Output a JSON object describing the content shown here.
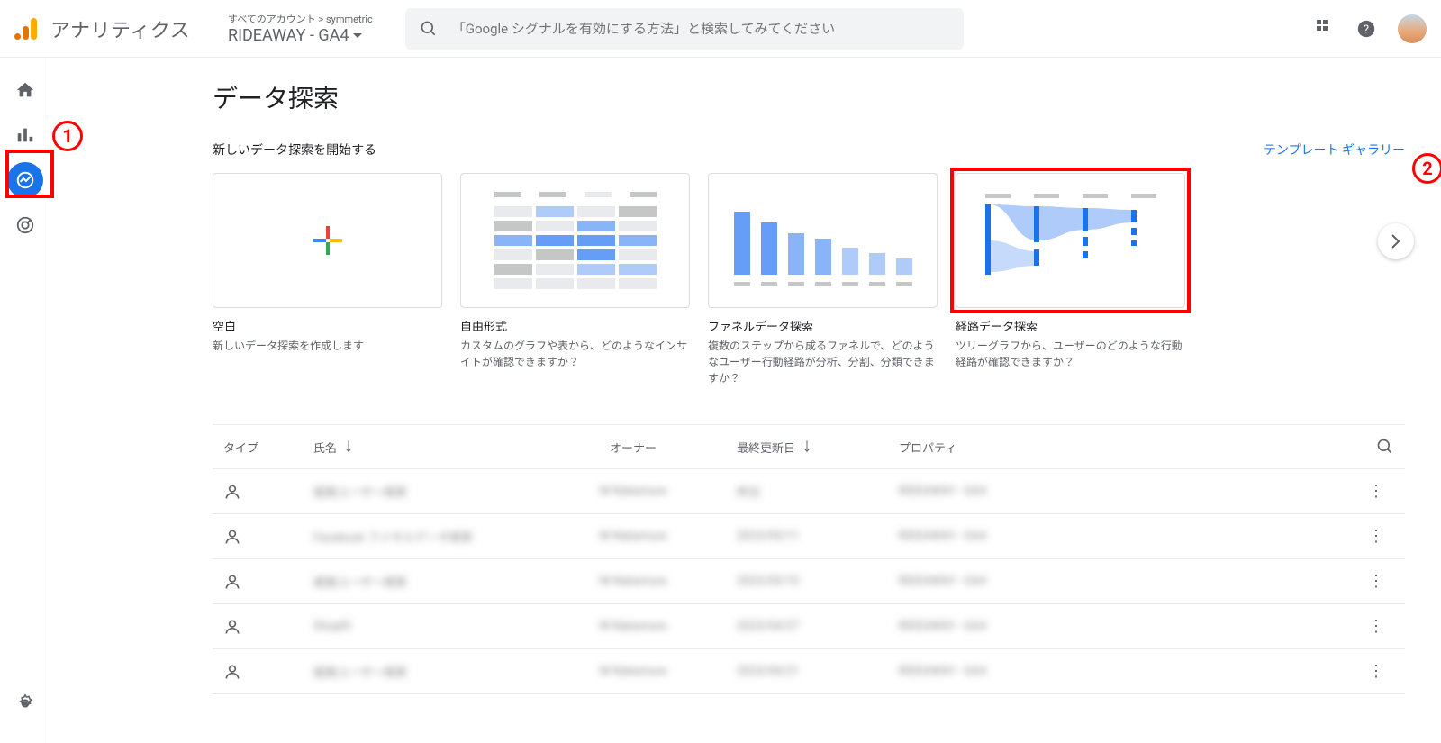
{
  "header": {
    "product_name": "アナリティクス",
    "account_path": "すべてのアカウント > symmetric",
    "property_name": "RIDEAWAY - GA4",
    "search_placeholder": "「Google シグナルを有効にする方法」と検索してみてください"
  },
  "annotations": {
    "one": "1",
    "two": "2"
  },
  "page": {
    "title": "データ探索",
    "start_new_label": "新しいデータ探索を開始する",
    "gallery_link": "テンプレート ギャラリー"
  },
  "templates": [
    {
      "title": "空白",
      "desc": "新しいデータ探索を作成します"
    },
    {
      "title": "自由形式",
      "desc": "カスタムのグラフや表から、どのようなインサイトが確認できますか？"
    },
    {
      "title": "ファネルデータ探索",
      "desc": "複数のステップから成るファネルで、どのようなユーザー行動経路が分析、分割、分類できますか？"
    },
    {
      "title": "経路データ探索",
      "desc": "ツリーグラフから、ユーザーのどのような行動経路が確認できますか？"
    }
  ],
  "table": {
    "headers": {
      "type": "タイプ",
      "name": "氏名",
      "owner": "オーナー",
      "last_modified": "最終更新日",
      "property": "プロパティ"
    },
    "rows": [
      {
        "name": "経路ユーザー探索",
        "owner": "M Nakamura",
        "date": "昨日",
        "property": "RIDEAWAY - GA4"
      },
      {
        "name": "Facebook ファネルデータ探索",
        "owner": "M Nakamura",
        "date": "2023/05/11",
        "property": "RIDEAWAY - GA4"
      },
      {
        "name": "経路ユーザー探索",
        "owner": "M Nakamura",
        "date": "2023/05/10",
        "property": "RIDEAWAY - GA4"
      },
      {
        "name": "ShopID",
        "owner": "M Nakamura",
        "date": "2023/04/27",
        "property": "RIDEAWAY - GA4"
      },
      {
        "name": "経路ユーザー探索",
        "owner": "M Nakamura",
        "date": "2023/04/21",
        "property": "RIDEAWAY - GA4"
      }
    ]
  }
}
